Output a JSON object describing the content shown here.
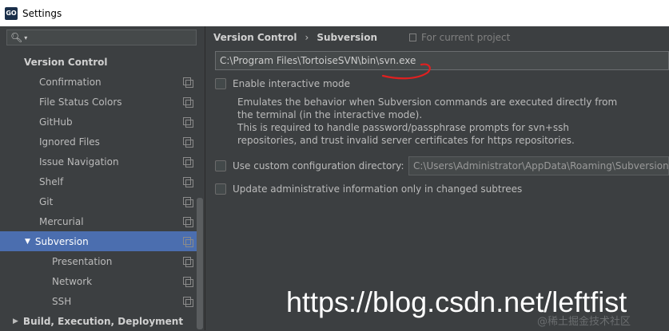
{
  "window": {
    "title": "Settings",
    "app_icon": "GO"
  },
  "sidebar": {
    "search_placeholder": "",
    "items": [
      {
        "label": "Version Control",
        "type": "section"
      },
      {
        "label": "Confirmation"
      },
      {
        "label": "File Status Colors"
      },
      {
        "label": "GitHub"
      },
      {
        "label": "Ignored Files"
      },
      {
        "label": "Issue Navigation"
      },
      {
        "label": "Shelf"
      },
      {
        "label": "Git"
      },
      {
        "label": "Mercurial"
      },
      {
        "label": "Subversion",
        "selected": true,
        "expanded": true
      },
      {
        "label": "Presentation"
      },
      {
        "label": "Network"
      },
      {
        "label": "SSH"
      },
      {
        "label": "Build, Execution, Deployment",
        "type": "section",
        "collapsed": true
      }
    ]
  },
  "main": {
    "breadcrumb": {
      "parent": "Version Control",
      "separator": "›",
      "current": "Subversion"
    },
    "project_note": "For current project",
    "svn_path": "C:\\Program Files\\TortoiseSVN\\bin\\svn.exe",
    "interactive_mode": {
      "label": "Enable interactive mode",
      "checked": false,
      "description": [
        "Emulates the behavior when Subversion commands are executed directly from",
        "the terminal (in the interactive mode).",
        "This is required to handle password/passphrase prompts for svn+ssh",
        "repositories, and trust invalid server certificates for https repositories."
      ]
    },
    "custom_config": {
      "label": "Use custom configuration directory:",
      "checked": false,
      "value": "C:\\Users\\Administrator\\AppData\\Roaming\\Subversion"
    },
    "update_admin": {
      "label": "Update administrative information only in changed subtrees",
      "checked": false
    }
  },
  "watermark": {
    "url": "https://blog.csdn.net/leftfist",
    "small": "@稀土掘金技术社区"
  },
  "colors": {
    "selection": "#4b6eaf",
    "background": "#3c3f41",
    "annotation_red": "#e02020"
  }
}
